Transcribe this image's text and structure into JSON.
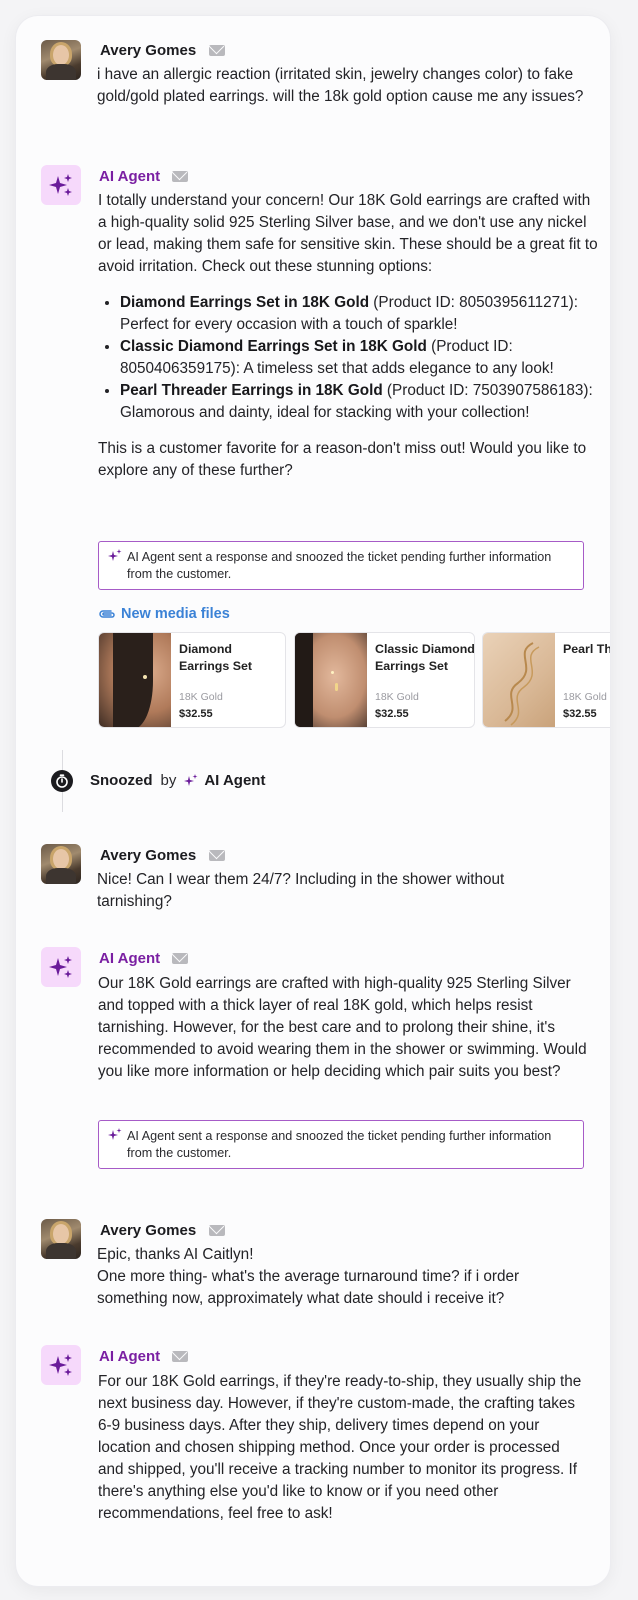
{
  "thread": {
    "msg1": {
      "author": "Avery Gomes",
      "text": "i have an allergic reaction (irritated skin, jewelry changes color) to fake gold/gold plated earrings. will the 18k gold option cause me any issues?"
    },
    "msg2": {
      "author": "AI Agent",
      "intro": "I totally understand your concern! Our 18K Gold earrings are crafted with a high-quality solid 925 Sterling Silver base, and we don't use any nickel or lead, making them safe for sensitive skin. These should be a great fit to avoid irritation. Check out these stunning options:",
      "bullets": [
        {
          "title": "Diamond Earrings Set in 18K Gold",
          "rest": " (Product ID: 8050395611271): Perfect for every occasion with a touch of sparkle!"
        },
        {
          "title": "Classic Diamond Earrings Set in 18K Gold",
          "rest": " (Product ID: 8050406359175): A timeless set that adds elegance to any look!"
        },
        {
          "title": "Pearl Threader Earrings in 18K Gold",
          "rest": " (Product ID: 7503907586183): Glamorous and dainty, ideal for stacking with your collection!"
        }
      ],
      "outro": "This is a customer favorite for a reason-don't miss out! Would you like to explore any of these further?",
      "notice": "AI Agent sent a response and snoozed the ticket pending further information from the customer.",
      "media_title": "New media files",
      "products": [
        {
          "name": "Diamond Earrings Set",
          "variant": "18K Gold",
          "price": "$32.55"
        },
        {
          "name": "Classic Diamond Earrings Set",
          "variant": "18K Gold",
          "price": "$32.55"
        },
        {
          "name": "Pearl Threader Earrings",
          "variant": "18K Gold",
          "price": "$32.55"
        }
      ]
    },
    "snooze": {
      "status": "Snoozed",
      "by": "by",
      "actor": "AI Agent"
    },
    "msg3": {
      "author": "Avery Gomes",
      "text": "Nice! Can I wear them 24/7? Including in the shower without tarnishing?"
    },
    "msg4": {
      "author": "AI Agent",
      "text": "Our 18K Gold earrings are crafted with high-quality 925 Sterling Silver and topped with a thick layer of real 18K gold, which helps resist tarnishing. However, for the best care and to prolong their shine, it's recommended to avoid wearing them in the shower or swimming. Would you like more information or help deciding which pair suits you best?",
      "notice": "AI Agent sent a response and snoozed the ticket pending further information from the customer."
    },
    "msg5": {
      "author": "Avery Gomes",
      "line1": "Epic, thanks AI Caitlyn!",
      "line2": "One more thing- what's the average turnaround time? if i order something now, approximately what date should i receive it?"
    },
    "msg6": {
      "author": "AI Agent",
      "text": "For our 18K Gold earrings, if they're ready-to-ship, they usually ship the next business day. However, if they're custom-made, the crafting takes 6-9 business days. After they ship, delivery times depend on your location and chosen shipping method. Once your order is processed and shipped, you'll receive a tracking number to monitor its progress. If there's anything else you'd like to know or if you need other recommendations, feel free to ask!"
    }
  },
  "icons": {
    "email": "envelope-icon",
    "ai": "sparkles-icon",
    "attachment": "paperclip-icon",
    "snooze": "stopwatch-icon"
  },
  "colors": {
    "agent_name": "#7a1fa2",
    "agent_tile": "#f6d9fb",
    "notice_border": "#a65bc7",
    "link": "#3b82d6"
  }
}
